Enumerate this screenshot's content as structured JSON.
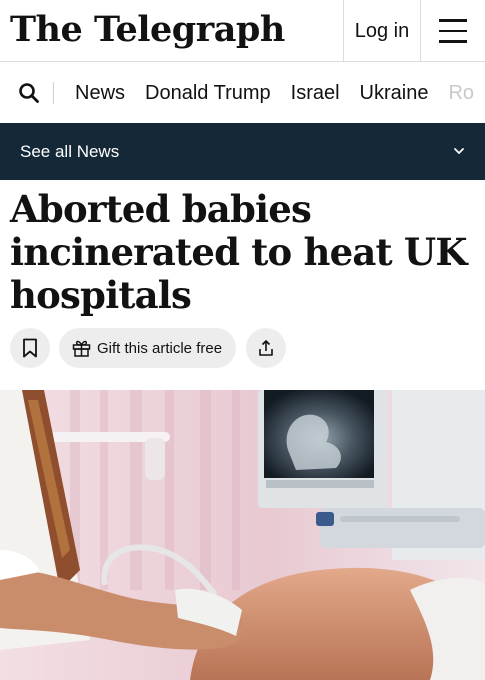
{
  "header": {
    "masthead": "The Telegraph",
    "login_label": "Log in",
    "menu_icon": "hamburger-menu-icon"
  },
  "nav": {
    "search_icon": "search-icon",
    "items": [
      "News",
      "Donald Trump",
      "Israel",
      "Ukraine",
      "Ro"
    ]
  },
  "section_bar": {
    "label": "See all News",
    "icon": "chevron-down-icon",
    "background": "#142838"
  },
  "article": {
    "headline": "Aborted babies incinerated to heat UK hospitals",
    "actions": {
      "bookmark_icon": "bookmark-icon",
      "gift_label": "Gift this article free",
      "gift_icon": "gift-icon",
      "share_icon": "share-icon"
    },
    "image": "ultrasound-scan-photo"
  }
}
